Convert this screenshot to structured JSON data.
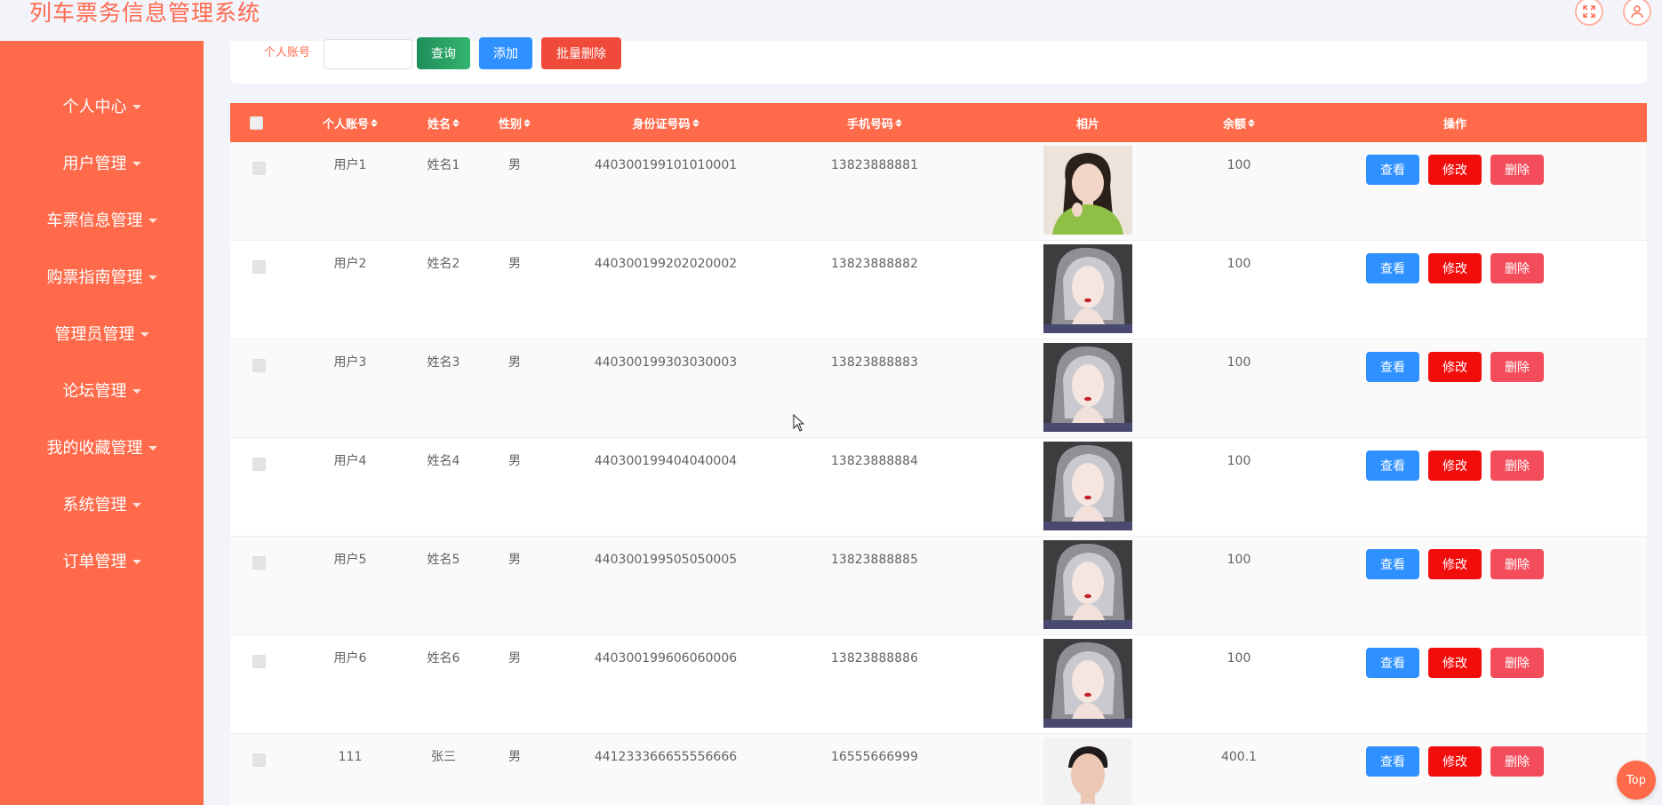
{
  "header": {
    "title": "列车票务信息管理系统",
    "icons": [
      "expand-icon",
      "user-icon"
    ]
  },
  "sidebar": {
    "items": [
      {
        "label": "个人中心"
      },
      {
        "label": "用户管理"
      },
      {
        "label": "车票信息管理"
      },
      {
        "label": "购票指南管理"
      },
      {
        "label": "管理员管理"
      },
      {
        "label": "论坛管理"
      },
      {
        "label": "我的收藏管理"
      },
      {
        "label": "系统管理"
      },
      {
        "label": "订单管理"
      }
    ]
  },
  "search": {
    "label": "个人账号",
    "value": "",
    "placeholder": "",
    "query_label": "查询",
    "add_label": "添加",
    "batch_delete_label": "批量删除"
  },
  "table": {
    "columns": {
      "account": "个人账号",
      "name": "姓名",
      "gender": "性别",
      "id_number": "身份证号码",
      "phone": "手机号码",
      "photo": "相片",
      "balance": "余额",
      "actions": "操作"
    },
    "rows": [
      {
        "account": "用户1",
        "name": "姓名1",
        "gender": "男",
        "id_number": "440300199101010001",
        "phone": "13823888881",
        "balance": "100",
        "photo": "girl-green-sweater"
      },
      {
        "account": "用户2",
        "name": "姓名2",
        "gender": "男",
        "id_number": "440300199202020002",
        "phone": "13823888882",
        "balance": "100",
        "photo": "girl-gray-hair"
      },
      {
        "account": "用户3",
        "name": "姓名3",
        "gender": "男",
        "id_number": "440300199303030003",
        "phone": "13823888883",
        "balance": "100",
        "photo": "girl-gray-hair"
      },
      {
        "account": "用户4",
        "name": "姓名4",
        "gender": "男",
        "id_number": "440300199404040004",
        "phone": "13823888884",
        "balance": "100",
        "photo": "girl-gray-hair"
      },
      {
        "account": "用户5",
        "name": "姓名5",
        "gender": "男",
        "id_number": "440300199505050005",
        "phone": "13823888885",
        "balance": "100",
        "photo": "girl-gray-hair"
      },
      {
        "account": "用户6",
        "name": "姓名6",
        "gender": "男",
        "id_number": "440300199606060006",
        "phone": "13823888886",
        "balance": "100",
        "photo": "girl-gray-hair"
      },
      {
        "account": "111",
        "name": "张三",
        "gender": "男",
        "id_number": "441233366655556666",
        "phone": "16555666999",
        "balance": "400.1",
        "photo": "man-portrait"
      }
    ],
    "action_labels": {
      "view": "查看",
      "edit": "修改",
      "delete": "删除"
    }
  },
  "top_button": "Top",
  "colors": {
    "accent": "#ff6a4a",
    "title": "#ff6a4f",
    "view": "#2f91ff",
    "edit": "#f20d0d",
    "delete": "#f34d5c",
    "query": "#1e8f5a"
  }
}
